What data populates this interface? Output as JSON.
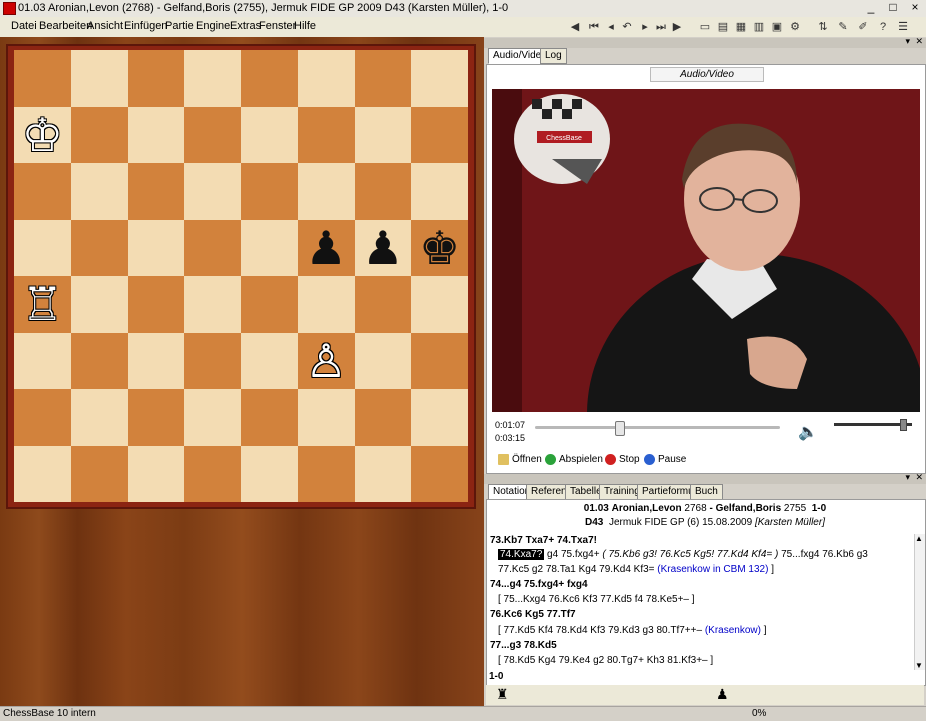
{
  "window": {
    "title": "01.03 Aronian,Levon (2768) - Gelfand,Boris (2755), Jermuk FIDE GP 2009  D43  (Karsten Müller), 1-0",
    "minimize": "_",
    "maximize": "□",
    "close": "×"
  },
  "menu": [
    "Datei",
    "Bearbeiten",
    "Ansicht",
    "Einfügen",
    "Partie",
    "Engine",
    "Extras",
    "Fenster",
    "Hilfe"
  ],
  "toolbar_icons": [
    "nav-back-icon",
    "first-move-icon",
    "prev-move-icon",
    "undo-icon",
    "next-move-icon",
    "last-move-icon",
    "nav-forward-icon",
    "new-icon",
    "open-icon",
    "save-icon",
    "print-icon",
    "board-icon",
    "engine-icon",
    "flip-icon",
    "annotate-icon",
    "help-icon"
  ],
  "board": {
    "light_color": "#f3dcb3",
    "dark_color": "#d2823c",
    "pieces": [
      {
        "square": "a7",
        "piece": "♔",
        "color": "white",
        "name": "white-king"
      },
      {
        "square": "f5",
        "piece": "♟",
        "color": "black",
        "name": "black-pawn-f5"
      },
      {
        "square": "g5",
        "piece": "♟",
        "color": "black",
        "name": "black-pawn-g5"
      },
      {
        "square": "h5",
        "piece": "♚",
        "color": "black",
        "name": "black-king"
      },
      {
        "square": "a4",
        "piece": "♖",
        "color": "white",
        "name": "white-rook"
      },
      {
        "square": "f3",
        "piece": "♙",
        "color": "white",
        "name": "white-pawn-f3"
      }
    ]
  },
  "av_panel": {
    "tabs": [
      "Audio/Video",
      "Log"
    ],
    "caption": "Audio/Video",
    "video_logo": "ChessBase",
    "time_current": "0:01:07",
    "time_total": "0:03:15",
    "seek_position": 0.343,
    "volume_level": 0.88,
    "buttons": {
      "open": "Öffnen",
      "play": "Abspielen",
      "stop": "Stop",
      "pause": "Pause"
    }
  },
  "notation_panel": {
    "tabs": [
      "Notation",
      "Referenz",
      "Tabelle",
      "Training",
      "Partieformular",
      "Buch"
    ],
    "header1_num": "01.03",
    "header1_white": "Aronian,Levon",
    "header1_white_elo": "2768",
    "header1_sep": "-",
    "header1_black": "Gelfand,Boris",
    "header1_black_elo": "2755",
    "header1_result": "1-0",
    "header2_eco": "D43",
    "header2_event": "Jermuk FIDE GP (6)",
    "header2_date": "15.08.2009",
    "header2_annotator": "[Karsten Müller]",
    "l1": "73.Kb7  Txa7+  74.Txa7!",
    "l2_hl": "74.Kxa7?",
    "l2_a": " g4  75.fxg4+  ",
    "l2_b": "( 75.Kb6  g3!  76.Kc5  Kg5!  77.Kd4  Kf4= )",
    "l2_c": " 75...fxg4  76.Kb6  g3",
    "l3_a": "77.Kc5  g2  78.Ta1  Kg4  79.Kd4  Kf3= ",
    "l3_link": "(Krasenkow in CBM 132)",
    "l3_b": " ]",
    "l4": "74...g4  75.fxg4+  fxg4",
    "l5": "[ 75...Kxg4  76.Kc6  Kf3  77.Kd5  f4  78.Ke5+– ]",
    "l6": "76.Kc6  Kg5  77.Tf7",
    "l7_a": "[ 77.Kd5  Kf4  78.Kd4  Kf3  79.Kd3  g3  80.Tf7++– ",
    "l7_link": "(Krasenkow)",
    "l7_b": " ]",
    "l8": "77...g3  78.Kd5",
    "l9": "[ 78.Kd5  Kg4  79.Ke4  g2  80.Tg7+  Kh3  81.Kf3+– ]",
    "result": "1-0",
    "white_to_move_icon": "♜",
    "black_icon": "♟"
  },
  "status": {
    "left": "ChessBase 10 intern",
    "progress": "0%"
  }
}
